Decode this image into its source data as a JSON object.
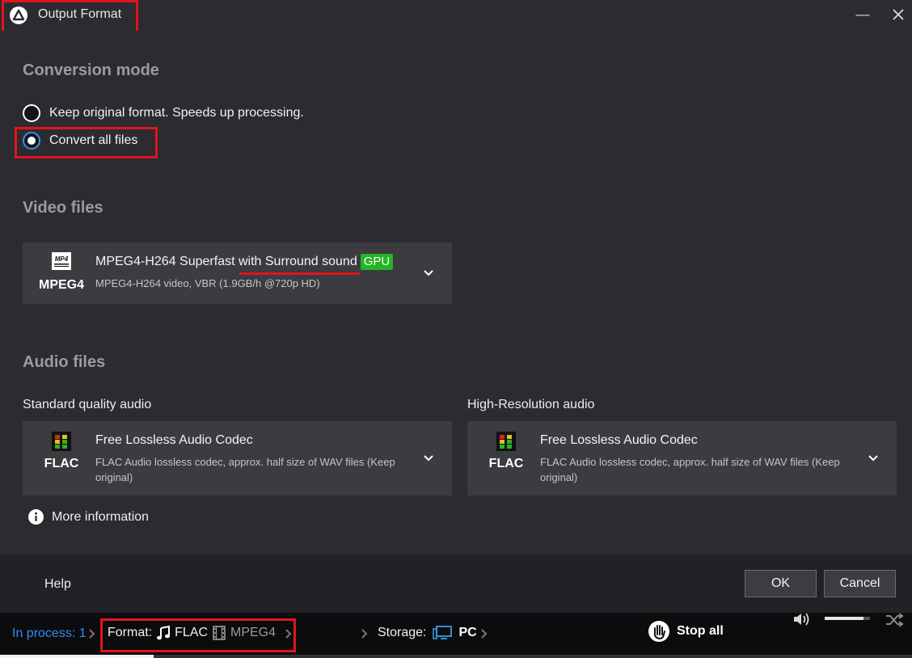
{
  "window": {
    "title": "Output Format",
    "minimize_icon": "minimize-icon",
    "close_icon": "close-icon"
  },
  "conversion_mode": {
    "heading": "Conversion mode",
    "options": [
      {
        "label": "Keep original format. Speeds up processing.",
        "selected": false
      },
      {
        "label": "Convert all files",
        "selected": true
      }
    ]
  },
  "video_files": {
    "heading": "Video files",
    "format": {
      "icon_name": "MPEG4",
      "icon_badge": "MP4",
      "title": "MPEG4-H264 Superfast with Surround sound",
      "badge": "GPU",
      "description": "MPEG4-H264 video, VBR (1.9GB/h @720p HD)"
    }
  },
  "audio_files": {
    "heading": "Audio files",
    "standard": {
      "label": "Standard quality audio",
      "icon_name": "FLAC",
      "title": "Free Lossless Audio Codec",
      "description": "FLAC Audio lossless codec, approx. half size of WAV files (Keep original)"
    },
    "high_res": {
      "label": "High-Resolution audio",
      "icon_name": "FLAC",
      "title": "Free Lossless Audio Codec",
      "description": "FLAC Audio lossless codec, approx. half size of WAV files (Keep original)"
    }
  },
  "more_information": "More information",
  "footer": {
    "help": "Help",
    "ok": "OK",
    "cancel": "Cancel"
  },
  "statusbar": {
    "in_process": "In process: 1",
    "format_label": "Format:",
    "audio_format": "FLAC",
    "video_format": "MPEG4",
    "storage_label": "Storage:",
    "storage_value": "PC",
    "stop_all": "Stop all"
  },
  "colors": {
    "accent_blue": "#2f8df0",
    "highlight_red": "#e2141d",
    "gpu_green": "#23b523",
    "panel": "#2b2b30",
    "card": "#3b3b40"
  }
}
